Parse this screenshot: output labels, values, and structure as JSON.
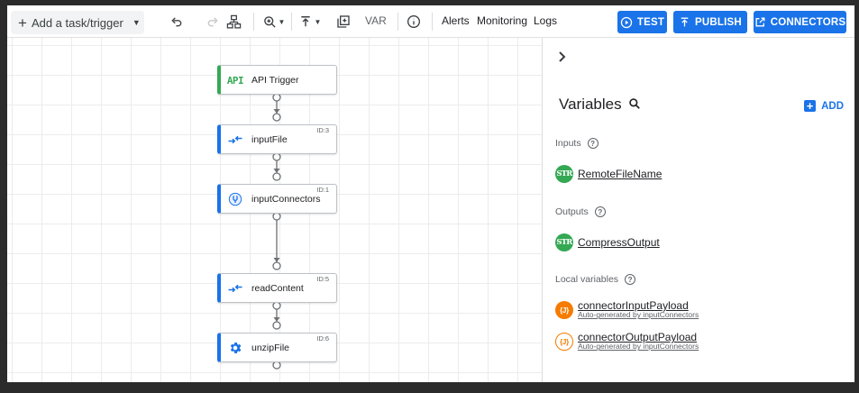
{
  "toolbar": {
    "add_task_label": "Add a task/trigger",
    "var_label": "VAR",
    "alerts_label": "Alerts",
    "monitoring_label": "Monitoring",
    "logs_label": "Logs",
    "test_label": "TEST",
    "publish_label": "PUBLISH",
    "connectors_label": "CONNECTORS",
    "primary_color": "#1a73e8"
  },
  "canvas": {
    "nodes": [
      {
        "label": "API Trigger",
        "id_label": "",
        "icon": "api-icon",
        "icon_text": "API"
      },
      {
        "label": "inputFile",
        "id_label": "ID:3",
        "icon": "data-mapping-icon"
      },
      {
        "label": "inputConnectors",
        "id_label": "ID:1",
        "icon": "connector-icon"
      },
      {
        "label": "readContent",
        "id_label": "ID:5",
        "icon": "data-mapping-icon"
      },
      {
        "label": "unzipFile",
        "id_label": "ID:6",
        "icon": "gear-icon"
      }
    ]
  },
  "panel": {
    "title": "Variables",
    "add_label": "ADD",
    "inputs_label": "Inputs",
    "outputs_label": "Outputs",
    "local_label": "Local variables",
    "inputs": [
      {
        "type": "STR",
        "name": "RemoteFileName"
      }
    ],
    "outputs": [
      {
        "type": "STR",
        "name": "CompressOutput"
      }
    ],
    "local": [
      {
        "type": "{J}",
        "name": "connectorInputPayload",
        "note": "Auto-generated by inputConnectors"
      },
      {
        "type": "{J}",
        "name": "connectorOutputPayload",
        "note": "Auto-generated by inputConnectors"
      }
    ]
  }
}
